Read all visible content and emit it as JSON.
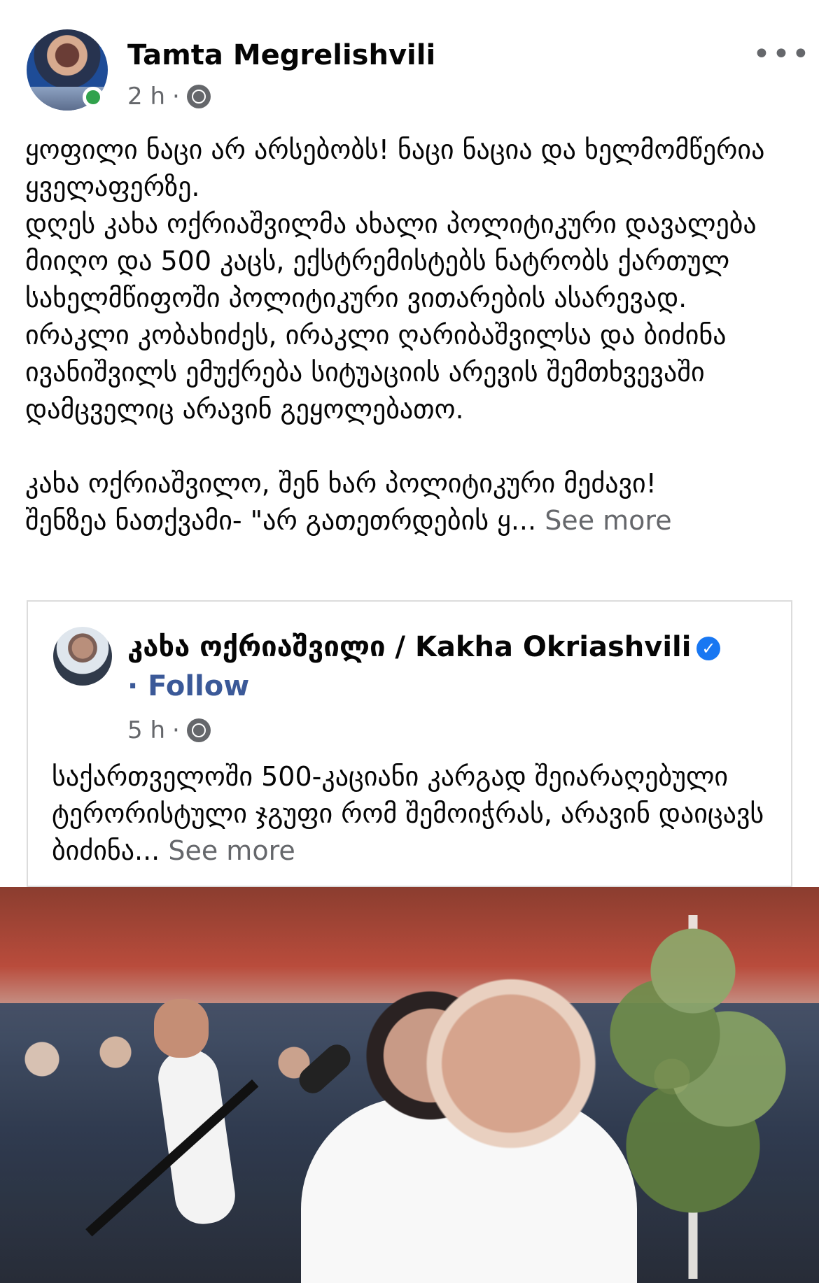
{
  "post": {
    "author": "Tamta Megrelishvili",
    "time": "2 h",
    "separator": "·",
    "more_icon": "more-options-icon",
    "text": "ყოფილი ნაცი არ არსებობს! ნაცი ნაცია და ხელმომწერია ყველაფერზე.\nდღეს კახა ოქრიაშვილმა ახალი პოლიტიკური დავალება მიიღო და 500 კაცს, ექსტრემისტებს ნატრობს ქართულ სახელმწიფოში პოლიტიკური ვითარების ასარევად.\nირაკლი კობახიძეს, ირაკლი ღარიბაშვილსა და ბიძინა ივანიშვილს ემუქრება სიტუაციის არევის შემთხვევაში დამცველიც არავინ გეყოლებათო.\n\nკახა ოქრიაშვილო, შენ ხარ პოლიტიკური მეძავი!\nშენზეა ნათქვამი- \"არ გათეთრდების ყ...",
    "see_more": "See more"
  },
  "shared_post": {
    "author": "კახა ოქრიაშვილი / Kakha Okriashvili",
    "verified_icon": "verified-badge-icon",
    "follow_prefix": "·",
    "follow_label": "Follow",
    "time": "5 h",
    "separator": "·",
    "text": "საქართველოში 500-კაციანი კარგად შეიარაღებული ტერორისტული ჯგუფი რომ შემოიჭრას, არავინ დაიცავს ბიძინა...",
    "see_more": "See more"
  },
  "colors": {
    "secondary_text": "#65676b",
    "link_blue": "#3b5998",
    "verified_blue": "#1877f2",
    "online_green": "#31a24c"
  }
}
